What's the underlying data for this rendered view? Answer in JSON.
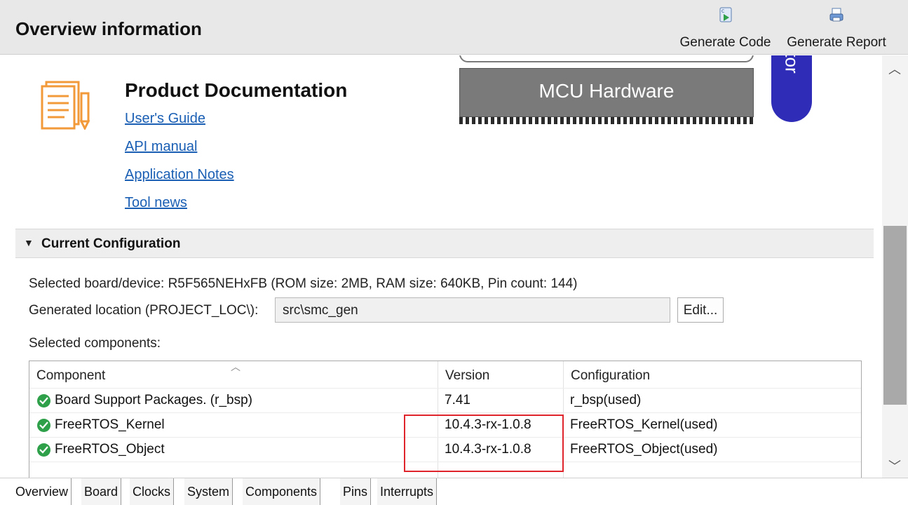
{
  "header": {
    "title": "Overview information",
    "generate_code": "Generate Code",
    "generate_report": "Generate Report"
  },
  "documentation": {
    "title": "Product Documentation",
    "links": [
      "User's Guide",
      "API manual",
      "Application Notes",
      "Tool news"
    ]
  },
  "diagram": {
    "chip_label": "MCU Hardware",
    "emulator_fragment": "tor"
  },
  "configuration": {
    "section_title": "Current Configuration",
    "selected_board": "Selected board/device: R5F565NEHxFB (ROM size: 2MB, RAM size: 640KB, Pin count: 144)",
    "generated_location_label": "Generated location (PROJECT_LOC\\):",
    "generated_location_value": "src\\smc_gen",
    "edit_button": "Edit...",
    "selected_components_label": "Selected components:"
  },
  "table": {
    "columns": [
      "Component",
      "Version",
      "Configuration"
    ],
    "rows": [
      {
        "component": "Board Support Packages. (r_bsp)",
        "version": "7.41",
        "configuration": "r_bsp(used)"
      },
      {
        "component": "FreeRTOS_Kernel",
        "version": "10.4.3-rx-1.0.8",
        "configuration": "FreeRTOS_Kernel(used)"
      },
      {
        "component": "FreeRTOS_Object",
        "version": "10.4.3-rx-1.0.8",
        "configuration": "FreeRTOS_Object(used)"
      }
    ]
  },
  "tabs": [
    "Overview",
    "Board",
    "Clocks",
    "System",
    "Components",
    "Pins",
    "Interrupts"
  ],
  "active_tab": "Overview",
  "colors": {
    "link": "#1a5fb4",
    "highlight_box": "#e0242c",
    "check": "#2ea04a",
    "emulator_pill": "#2f2db8",
    "chip": "#7a7a7a",
    "doc_icon": "#f2993a"
  },
  "icons": {
    "generate_code": "generate-code-icon",
    "generate_report": "generate-report-icon",
    "documentation": "document-pencil-icon",
    "status": "check-circle-icon"
  }
}
